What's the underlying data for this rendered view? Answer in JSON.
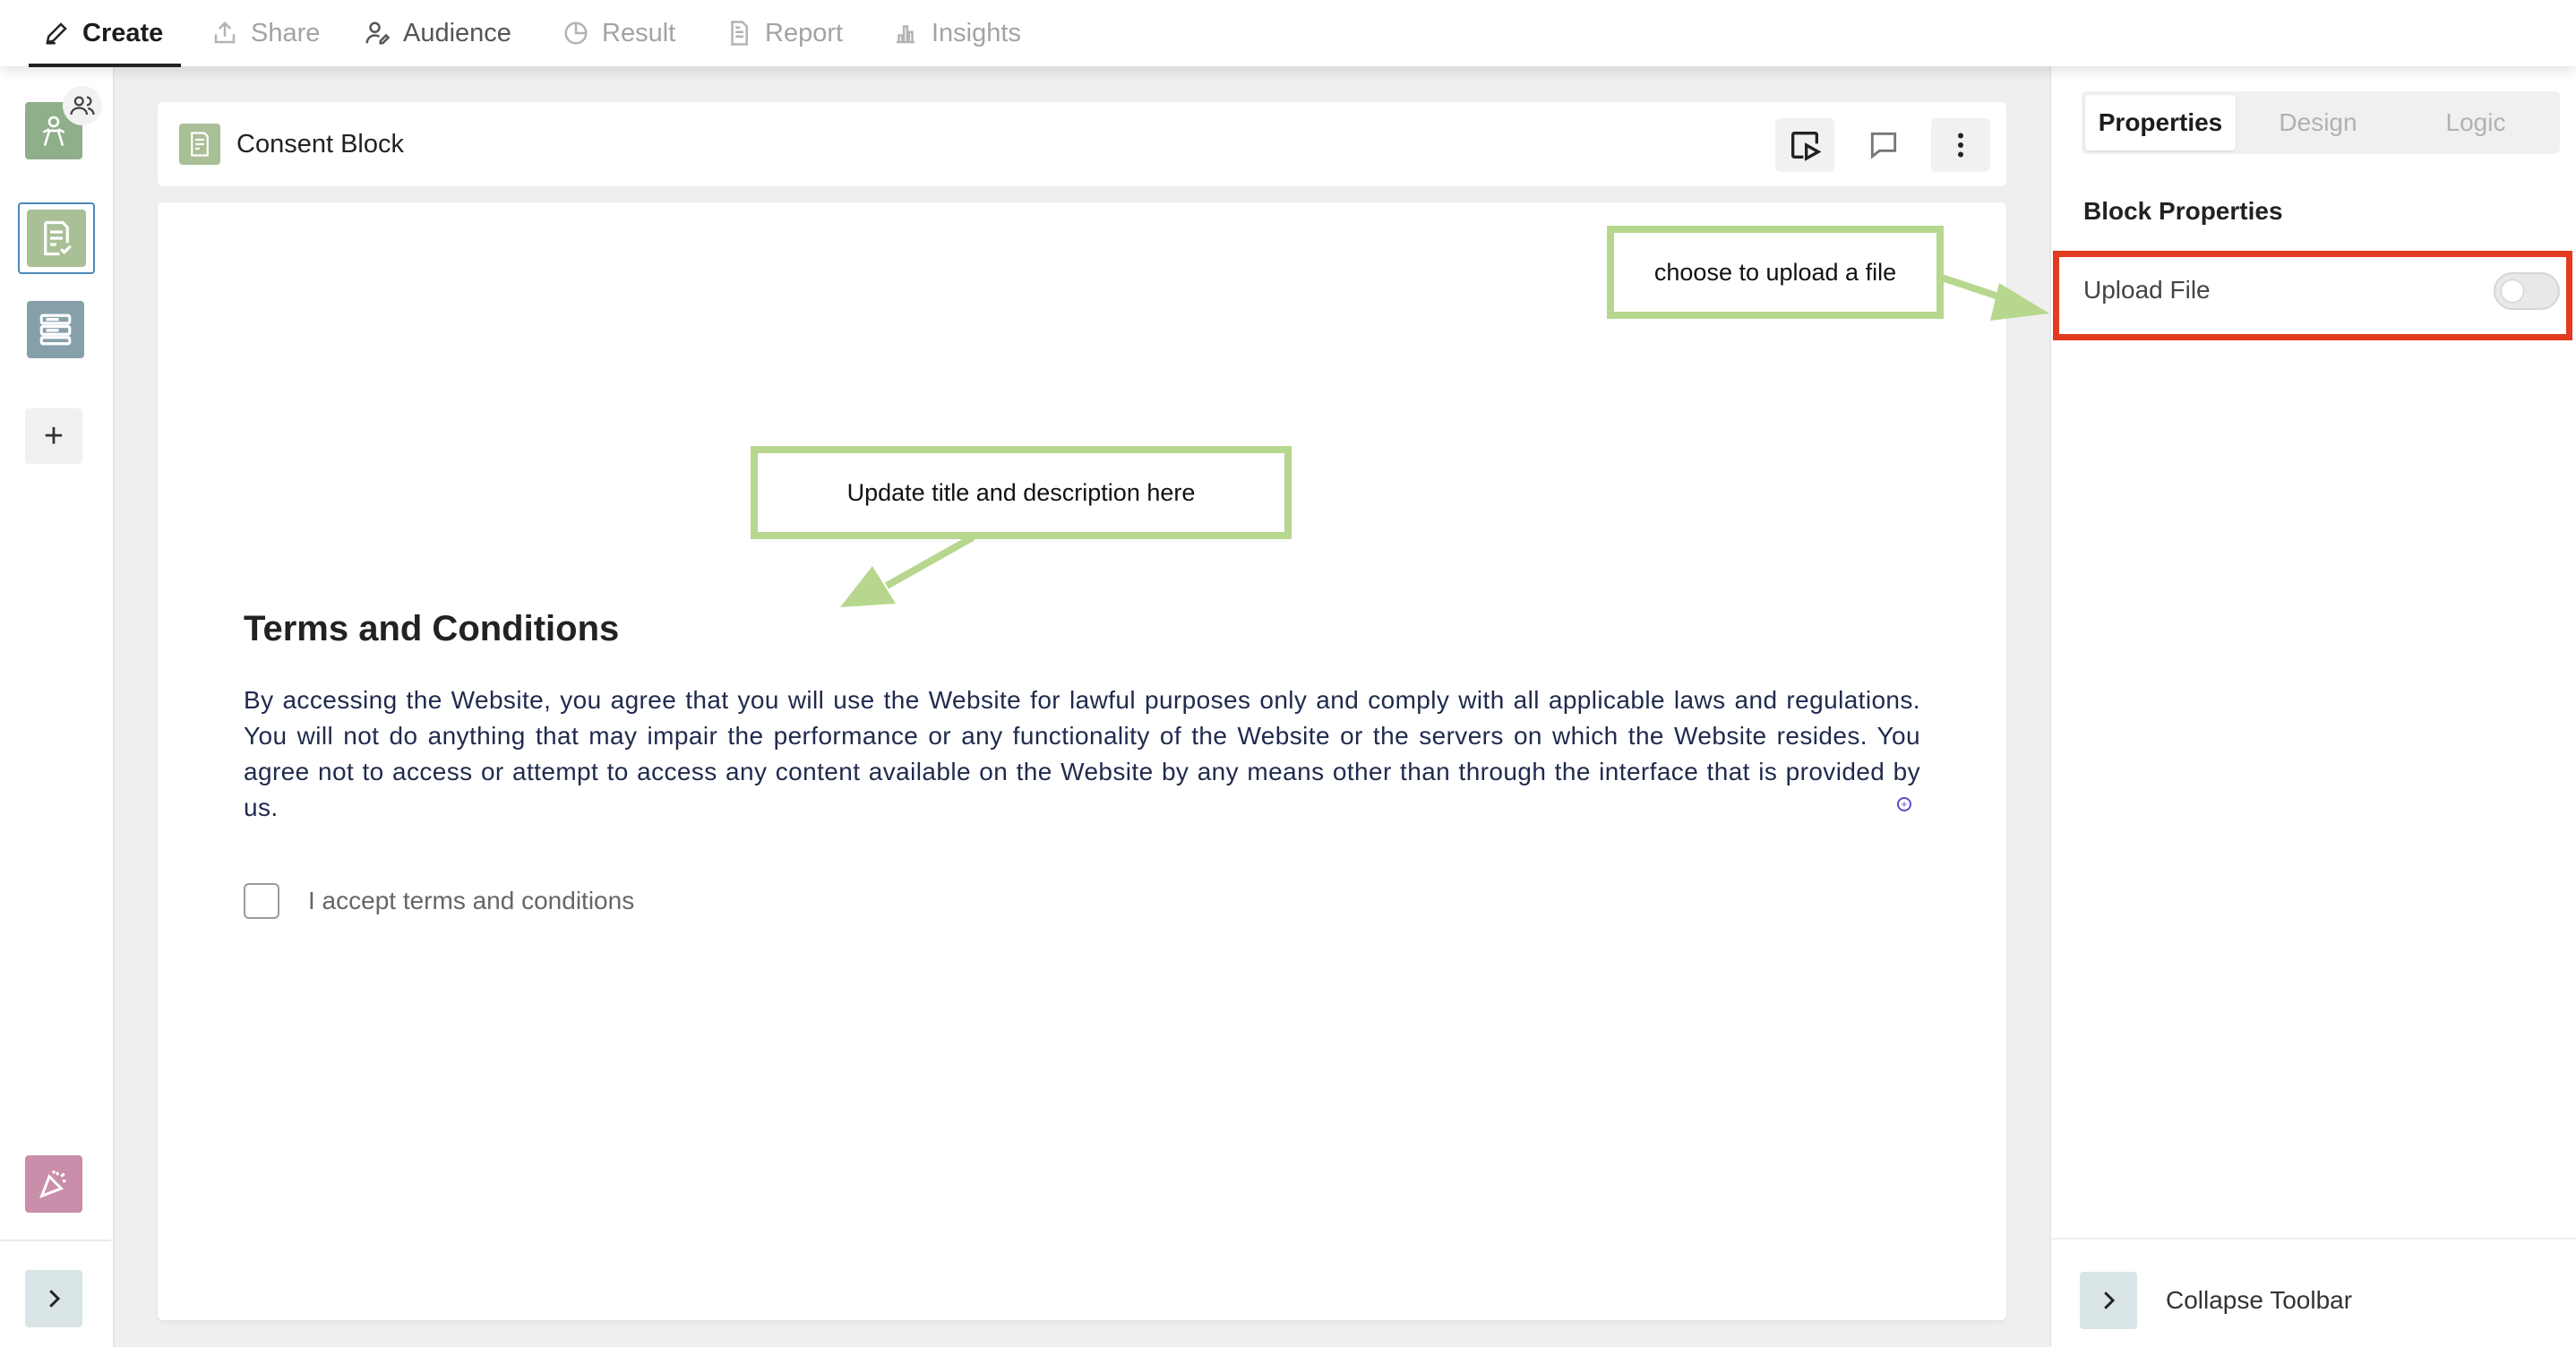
{
  "nav": {
    "tabs": [
      {
        "label": "Create",
        "icon": "pencil-icon"
      },
      {
        "label": "Share",
        "icon": "share-icon"
      },
      {
        "label": "Audience",
        "icon": "audience-icon"
      },
      {
        "label": "Result",
        "icon": "pie-chart-icon"
      },
      {
        "label": "Report",
        "icon": "report-icon"
      },
      {
        "label": "Insights",
        "icon": "bar-chart-icon"
      }
    ]
  },
  "block": {
    "title": "Consent Block",
    "heading": "Terms and Conditions",
    "description": "By accessing the Website, you agree that you will use the Website for lawful purposes only and comply with all applicable laws and regulations. You will not do anything that may impair the performance or any functionality of the Website or the servers on which the Website resides. You agree not to access or attempt to access any content available on the Website by any means other than through the interface that is provided by us.",
    "checkbox_label": "I accept terms and conditions"
  },
  "annotations": {
    "title_hint": "Update title and description here",
    "upload_hint": "choose to upload a file"
  },
  "panel": {
    "tabs": [
      "Properties",
      "Design",
      "Logic"
    ],
    "section_title": "Block Properties",
    "upload_label": "Upload File",
    "upload_enabled": false,
    "collapse_label": "Collapse Toolbar"
  },
  "colors": {
    "callout_green": "#b7d78f",
    "highlight_red": "#e23b1f",
    "body_text": "#1f2a4d"
  }
}
